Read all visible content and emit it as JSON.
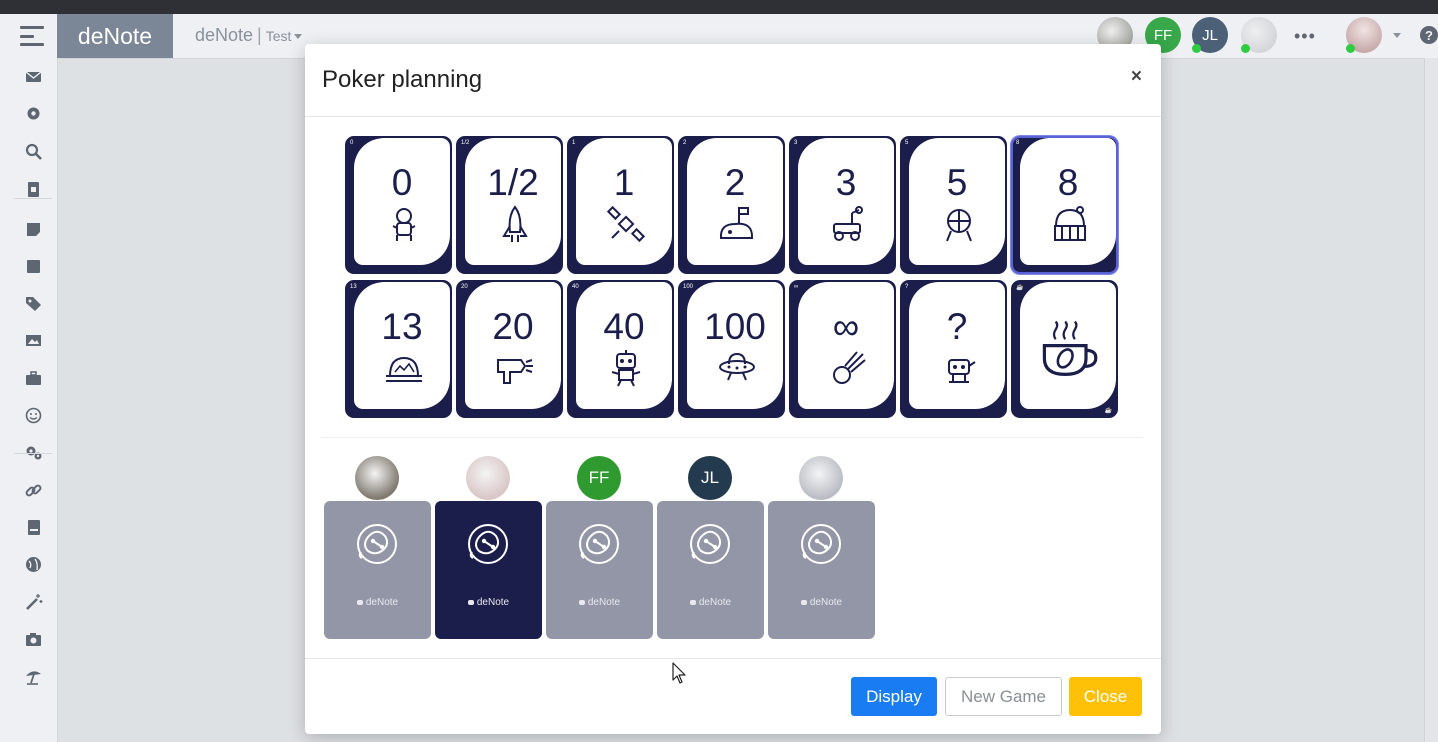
{
  "app": {
    "brand": "deNote",
    "crumb_doc": "deNote",
    "crumb_sep": "|",
    "crumb_sub": "Test"
  },
  "top_users": [
    {
      "kind": "photo",
      "color": "#8c8c86",
      "initials": ""
    },
    {
      "kind": "initials",
      "color": "#38a84a",
      "initials": "FF",
      "online": true
    },
    {
      "kind": "initials",
      "color": "#4c6078",
      "initials": "JL",
      "online": true
    },
    {
      "kind": "photo",
      "color": "#c8cbd1",
      "initials": "",
      "online": true
    }
  ],
  "sidebar": {
    "icons": [
      "mail-icon",
      "gear-icon",
      "search-icon",
      "document-icon",
      "note-icon",
      "square-icon",
      "tag-icon",
      "image-icon",
      "briefcase-icon",
      "smiley-icon",
      "cogs-icon",
      "link-icon",
      "book-icon",
      "globe-icon",
      "magic-wand-icon",
      "camera-icon",
      "beach-umbrella-icon"
    ]
  },
  "modal": {
    "title": "Poker planning",
    "close_glyph": "×"
  },
  "cards": [
    {
      "value": "0",
      "corner": "0",
      "icon": "astronaut-icon"
    },
    {
      "value": "1/2",
      "corner": "1/2",
      "icon": "rocket-icon"
    },
    {
      "value": "1",
      "corner": "1",
      "icon": "satellite-icon"
    },
    {
      "value": "2",
      "corner": "2",
      "icon": "moon-flag-icon"
    },
    {
      "value": "3",
      "corner": "3",
      "icon": "rover-icon"
    },
    {
      "value": "5",
      "corner": "5",
      "icon": "space-station-icon"
    },
    {
      "value": "8",
      "corner": "8",
      "icon": "observatory-icon",
      "selected": true
    },
    {
      "value": "13",
      "corner": "13",
      "icon": "dome-base-icon"
    },
    {
      "value": "20",
      "corner": "20",
      "icon": "ray-gun-icon"
    },
    {
      "value": "40",
      "corner": "40",
      "icon": "robot-alien-icon"
    },
    {
      "value": "100",
      "corner": "100",
      "icon": "ufo-icon"
    },
    {
      "value": "∞",
      "corner": "∞",
      "icon": "comet-icon"
    },
    {
      "value": "?",
      "corner": "?",
      "icon": "robot-question-icon"
    },
    {
      "value": "",
      "corner": "☕",
      "icon": "coffee-cup-icon"
    }
  ],
  "players": [
    {
      "avatar_kind": "photo",
      "avatar_color": "#7e786e",
      "initials": "",
      "voted": false,
      "brand": "deNote"
    },
    {
      "avatar_kind": "photo",
      "avatar_color": "#d9c6c6",
      "initials": "",
      "voted": true,
      "brand": "deNote"
    },
    {
      "avatar_kind": "initials",
      "avatar_color": "#2f9a2f",
      "initials": "FF",
      "voted": false,
      "brand": "deNote"
    },
    {
      "avatar_kind": "initials",
      "avatar_color": "#243a4e",
      "initials": "JL",
      "voted": false,
      "brand": "deNote"
    },
    {
      "avatar_kind": "photo",
      "avatar_color": "#b9bcc4",
      "initials": "",
      "voted": false,
      "brand": "deNote"
    }
  ],
  "buttons": {
    "display": "Display",
    "new_game": "New Game",
    "close": "Close"
  },
  "colors": {
    "card_navy": "#1b1e4b",
    "player_card_gray": "#9396a6",
    "display_blue": "#1a7cf2",
    "close_yellow": "#ffc107"
  }
}
